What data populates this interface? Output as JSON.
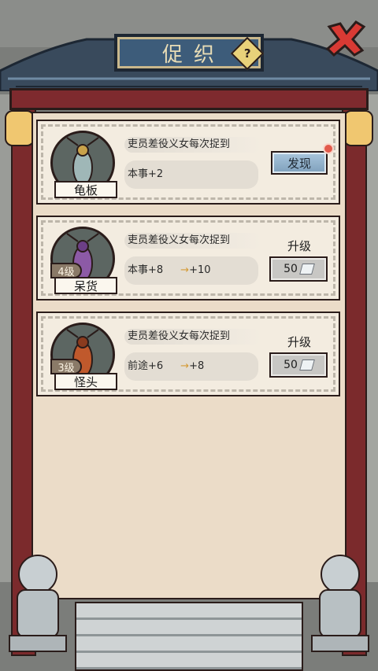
{
  "title": "促织",
  "help_label": "?",
  "cards": [
    {
      "name": "龟板",
      "level": "",
      "description": "吏员差役义女每次捉到",
      "stat_label": "本事+2",
      "stat_next": "",
      "action": "发现",
      "notification": true
    },
    {
      "name": "呆货",
      "level": "4级",
      "description": "吏员差役义女每次捉到",
      "stat_label": "本事+8",
      "stat_next": "+10",
      "upgrade_label": "升级",
      "cost": "50"
    },
    {
      "name": "怪头",
      "level": "3级",
      "description": "吏员差役义女每次捉到",
      "stat_label": "前途+6",
      "stat_next": "+8",
      "upgrade_label": "升级",
      "cost": "50"
    }
  ],
  "colors": {
    "pillar": "#7b2a2c",
    "plaque": "#3d5c7a",
    "panel": "#ebdcc8",
    "discover_button": "#8fb0cb",
    "notification_dot": "#e25a4b"
  },
  "icons": [
    "close-x-icon",
    "help-icon",
    "gem-icon",
    "lantern-icon"
  ]
}
